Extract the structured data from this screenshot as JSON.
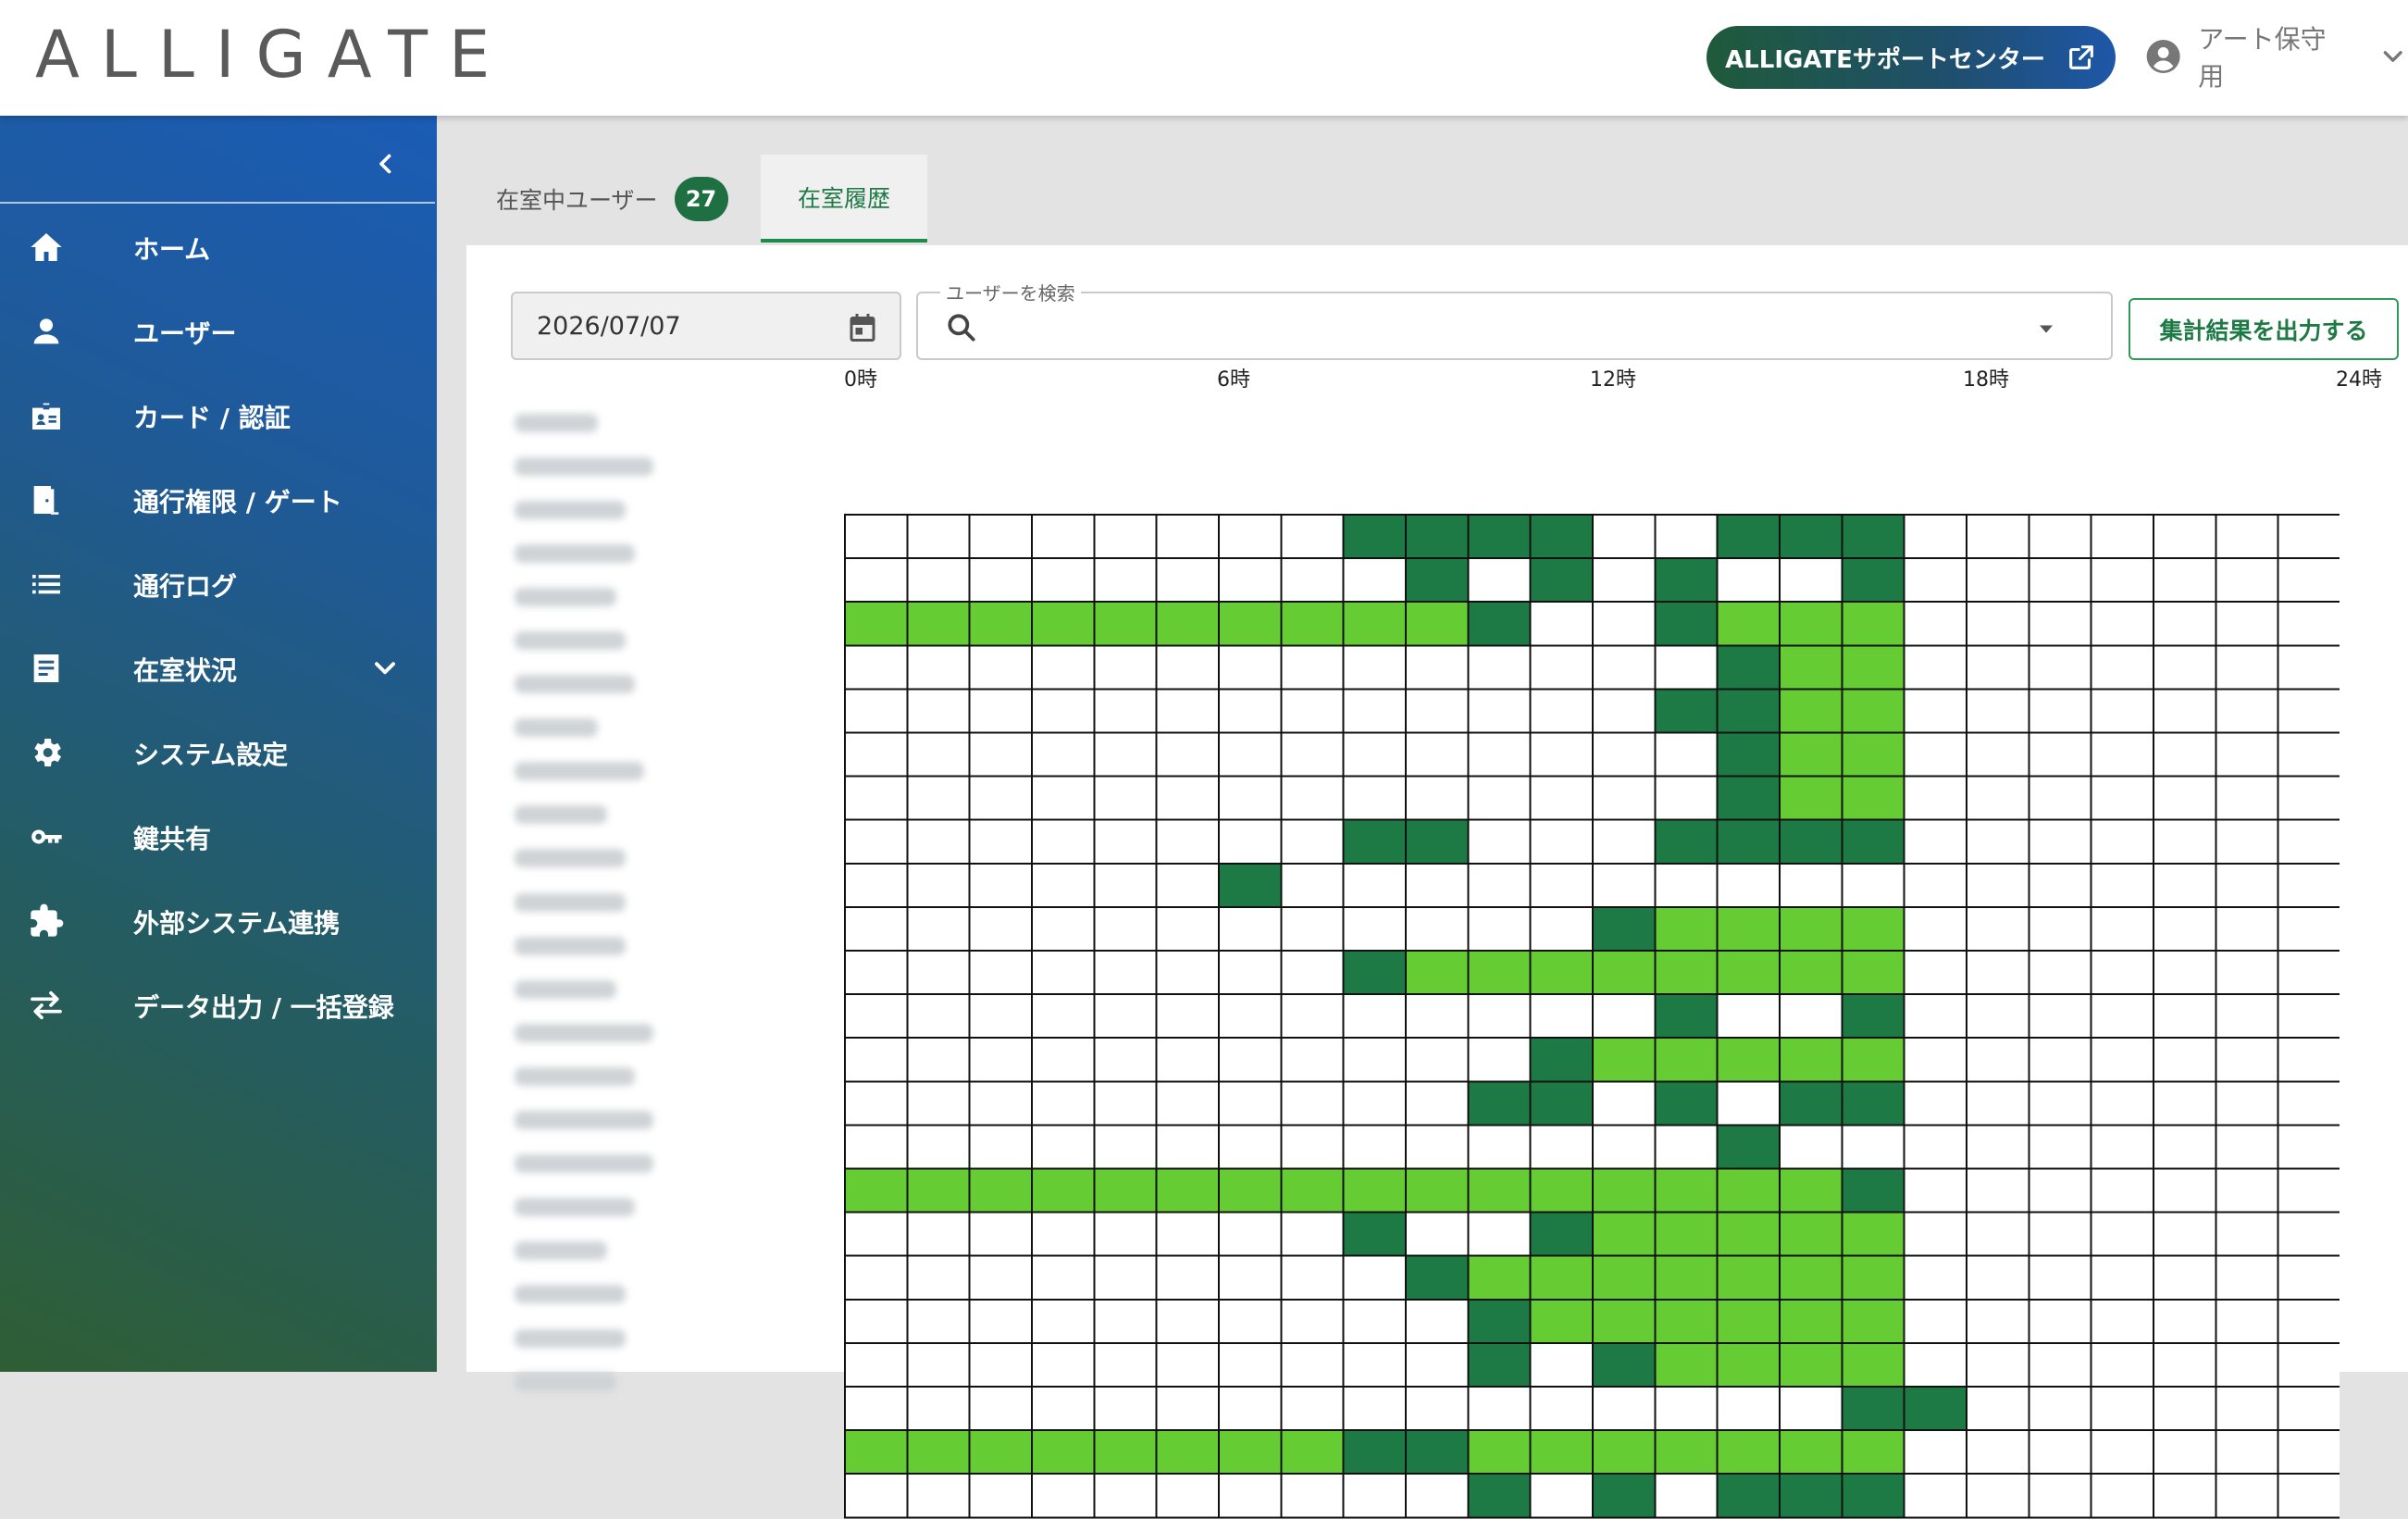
{
  "header": {
    "logo_text": "ALLIGATE",
    "support_button_label": "ALLIGATEサポートセンター",
    "user_name": "アート保守用"
  },
  "sidebar": {
    "items": [
      {
        "label": "ホーム",
        "icon": "home-icon"
      },
      {
        "label": "ユーザー",
        "icon": "person-icon"
      },
      {
        "label": "カード / 認証",
        "icon": "badge-icon"
      },
      {
        "label": "通行権限 / ゲート",
        "icon": "door-icon"
      },
      {
        "label": "通行ログ",
        "icon": "list-icon"
      },
      {
        "label": "在室状況",
        "icon": "assignment-icon",
        "expandable": true
      },
      {
        "label": "システム設定",
        "icon": "gear-icon"
      },
      {
        "label": "鍵共有",
        "icon": "key-icon"
      },
      {
        "label": "外部システム連携",
        "icon": "puzzle-icon"
      },
      {
        "label": "データ出力 / 一括登録",
        "icon": "swap-icon"
      }
    ]
  },
  "tabs": [
    {
      "label": "在室中ユーザー",
      "badge": "27",
      "active": false
    },
    {
      "label": "在室履歴",
      "active": true
    }
  ],
  "filters": {
    "date_value": "2026/07/07",
    "search_label": "ユーザーを検索",
    "search_value": "",
    "export_label": "集計結果を出力する"
  },
  "colors": {
    "dark_green": "#1e7a45",
    "light_green": "#66cc33",
    "accent_blue": "#1e57a8"
  },
  "chart_data": {
    "type": "heatmap",
    "hour_labels": [
      "0時",
      "6時",
      "12時",
      "18時",
      "24時"
    ],
    "columns": 24,
    "legend_codes": {
      "0": "empty",
      "1": "dark green",
      "2": "light green"
    },
    "rows": [
      [
        0,
        0,
        0,
        0,
        0,
        0,
        0,
        0,
        1,
        1,
        1,
        1,
        0,
        0,
        1,
        1,
        1,
        0,
        0,
        0,
        0,
        0,
        0,
        0
      ],
      [
        0,
        0,
        0,
        0,
        0,
        0,
        0,
        0,
        0,
        1,
        0,
        1,
        0,
        1,
        0,
        0,
        1,
        0,
        0,
        0,
        0,
        0,
        0,
        0
      ],
      [
        2,
        2,
        2,
        2,
        2,
        2,
        2,
        2,
        2,
        2,
        1,
        0,
        0,
        1,
        2,
        2,
        2,
        0,
        0,
        0,
        0,
        0,
        0,
        0
      ],
      [
        0,
        0,
        0,
        0,
        0,
        0,
        0,
        0,
        0,
        0,
        0,
        0,
        0,
        0,
        1,
        2,
        2,
        0,
        0,
        0,
        0,
        0,
        0,
        0
      ],
      [
        0,
        0,
        0,
        0,
        0,
        0,
        0,
        0,
        0,
        0,
        0,
        0,
        0,
        1,
        1,
        2,
        2,
        0,
        0,
        0,
        0,
        0,
        0,
        0
      ],
      [
        0,
        0,
        0,
        0,
        0,
        0,
        0,
        0,
        0,
        0,
        0,
        0,
        0,
        0,
        1,
        2,
        2,
        0,
        0,
        0,
        0,
        0,
        0,
        0
      ],
      [
        0,
        0,
        0,
        0,
        0,
        0,
        0,
        0,
        0,
        0,
        0,
        0,
        0,
        0,
        1,
        2,
        2,
        0,
        0,
        0,
        0,
        0,
        0,
        0
      ],
      [
        0,
        0,
        0,
        0,
        0,
        0,
        0,
        0,
        1,
        1,
        0,
        0,
        0,
        1,
        1,
        1,
        1,
        0,
        0,
        0,
        0,
        0,
        0,
        0
      ],
      [
        0,
        0,
        0,
        0,
        0,
        0,
        1,
        0,
        0,
        0,
        0,
        0,
        0,
        0,
        0,
        0,
        0,
        0,
        0,
        0,
        0,
        0,
        0,
        0
      ],
      [
        0,
        0,
        0,
        0,
        0,
        0,
        0,
        0,
        0,
        0,
        0,
        0,
        1,
        2,
        2,
        2,
        2,
        0,
        0,
        0,
        0,
        0,
        0,
        0
      ],
      [
        0,
        0,
        0,
        0,
        0,
        0,
        0,
        0,
        1,
        2,
        2,
        2,
        2,
        2,
        2,
        2,
        2,
        0,
        0,
        0,
        0,
        0,
        0,
        0
      ],
      [
        0,
        0,
        0,
        0,
        0,
        0,
        0,
        0,
        0,
        0,
        0,
        0,
        0,
        1,
        0,
        0,
        1,
        0,
        0,
        0,
        0,
        0,
        0,
        0
      ],
      [
        0,
        0,
        0,
        0,
        0,
        0,
        0,
        0,
        0,
        0,
        0,
        1,
        2,
        2,
        2,
        2,
        2,
        0,
        0,
        0,
        0,
        0,
        0,
        0
      ],
      [
        0,
        0,
        0,
        0,
        0,
        0,
        0,
        0,
        0,
        0,
        1,
        1,
        0,
        1,
        0,
        1,
        1,
        0,
        0,
        0,
        0,
        0,
        0,
        0
      ],
      [
        0,
        0,
        0,
        0,
        0,
        0,
        0,
        0,
        0,
        0,
        0,
        0,
        0,
        0,
        1,
        0,
        0,
        0,
        0,
        0,
        0,
        0,
        0,
        0
      ],
      [
        2,
        2,
        2,
        2,
        2,
        2,
        2,
        2,
        2,
        2,
        2,
        2,
        2,
        2,
        2,
        2,
        1,
        0,
        0,
        0,
        0,
        0,
        0,
        0
      ],
      [
        0,
        0,
        0,
        0,
        0,
        0,
        0,
        0,
        1,
        0,
        0,
        1,
        2,
        2,
        2,
        2,
        2,
        0,
        0,
        0,
        0,
        0,
        0,
        0
      ],
      [
        0,
        0,
        0,
        0,
        0,
        0,
        0,
        0,
        0,
        1,
        2,
        2,
        2,
        2,
        2,
        2,
        2,
        0,
        0,
        0,
        0,
        0,
        0,
        0
      ],
      [
        0,
        0,
        0,
        0,
        0,
        0,
        0,
        0,
        0,
        0,
        1,
        2,
        2,
        2,
        2,
        2,
        2,
        0,
        0,
        0,
        0,
        0,
        0,
        0
      ],
      [
        0,
        0,
        0,
        0,
        0,
        0,
        0,
        0,
        0,
        0,
        1,
        0,
        1,
        2,
        2,
        2,
        2,
        0,
        0,
        0,
        0,
        0,
        0,
        0
      ],
      [
        0,
        0,
        0,
        0,
        0,
        0,
        0,
        0,
        0,
        0,
        0,
        0,
        0,
        0,
        0,
        0,
        1,
        1,
        0,
        0,
        0,
        0,
        0,
        0
      ],
      [
        2,
        2,
        2,
        2,
        2,
        2,
        2,
        2,
        1,
        1,
        2,
        2,
        2,
        2,
        2,
        2,
        2,
        0,
        0,
        0,
        0,
        0,
        0,
        0
      ],
      [
        0,
        0,
        0,
        0,
        0,
        0,
        0,
        0,
        0,
        0,
        1,
        0,
        1,
        0,
        1,
        1,
        1,
        0,
        0,
        0,
        0,
        0,
        0,
        0
      ]
    ]
  }
}
